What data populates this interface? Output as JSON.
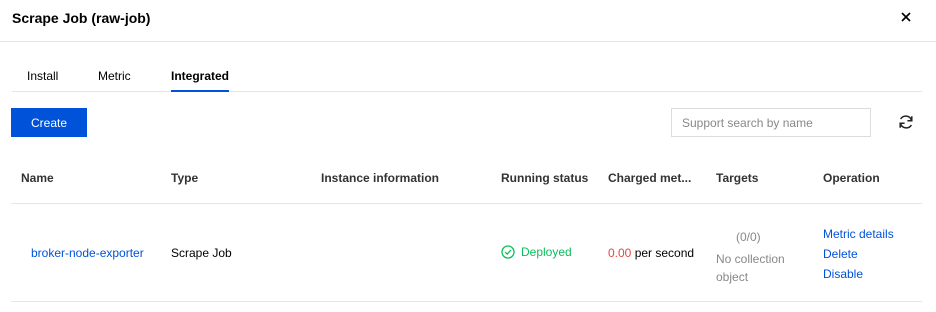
{
  "dialog": {
    "title": "Scrape Job (raw-job)"
  },
  "tabs": [
    {
      "label": "Install"
    },
    {
      "label": "Metric"
    },
    {
      "label": "Integrated"
    }
  ],
  "toolbar": {
    "create_label": "Create",
    "search_placeholder": "Support search by name"
  },
  "table": {
    "columns": [
      "Name",
      "Type",
      "Instance information",
      "Running status",
      "Charged met...",
      "Targets",
      "Operation"
    ],
    "rows": [
      {
        "name": "broker-node-exporter",
        "type": "Scrape Job",
        "instance_information": "",
        "running_status": "Deployed",
        "charged_value": "0.00",
        "charged_unit": "per second",
        "targets_count": "(0/0)",
        "targets_note_line1": "No collection",
        "targets_note_line2": "object",
        "operations": [
          "Metric details",
          "Delete",
          "Disable"
        ]
      }
    ]
  },
  "colors": {
    "primary": "#0052d9",
    "success": "#0abf5b",
    "danger": "#e54545"
  },
  "icons": [
    "close-icon",
    "refresh-icon",
    "check-circle-icon"
  ]
}
